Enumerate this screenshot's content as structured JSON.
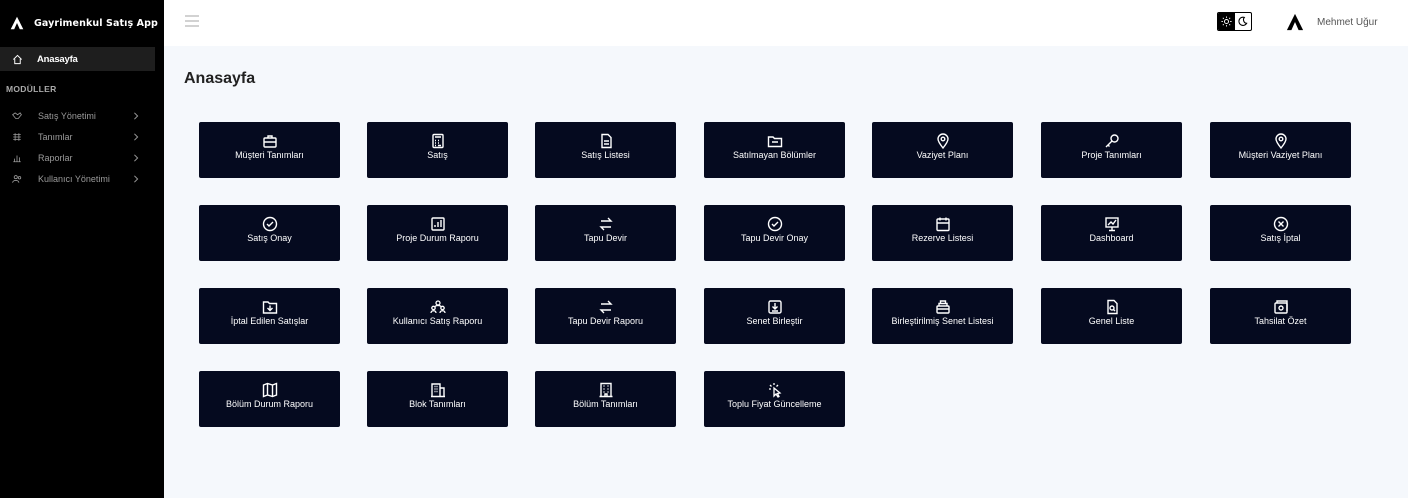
{
  "app": {
    "title": "Gayrimenkul Satış App"
  },
  "sidebar": {
    "active_item": {
      "label": "Anasayfa",
      "icon": "home-icon"
    },
    "section_title": "MODÜLLER",
    "items": [
      {
        "label": "Satış Yönetimi",
        "icon": "handshake-icon"
      },
      {
        "label": "Tanımlar",
        "icon": "grid-icon"
      },
      {
        "label": "Raporlar",
        "icon": "bar-chart-icon"
      },
      {
        "label": "Kullanıcı Yönetimi",
        "icon": "users-icon"
      }
    ]
  },
  "header": {
    "user_name": "Mehmet Uğur",
    "theme_options": [
      "light",
      "dark"
    ]
  },
  "main": {
    "page_title": "Anasayfa",
    "tiles": [
      {
        "label": "Müşteri Tanımları",
        "icon": "briefcase-icon"
      },
      {
        "label": "Satış",
        "icon": "calculator-icon"
      },
      {
        "label": "Satış Listesi",
        "icon": "document-icon"
      },
      {
        "label": "Satılmayan Bölümler",
        "icon": "folder-icon"
      },
      {
        "label": "Vaziyet Planı",
        "icon": "location-pin-icon"
      },
      {
        "label": "Proje Tanımları",
        "icon": "key-icon"
      },
      {
        "label": "Müşteri Vaziyet Planı",
        "icon": "location-pin-icon"
      },
      {
        "label": "Satış Onay",
        "icon": "check-circle-icon"
      },
      {
        "label": "Proje Durum Raporu",
        "icon": "bar-chart-icon"
      },
      {
        "label": "Tapu Devir",
        "icon": "transfer-arrows-icon"
      },
      {
        "label": "Tapu Devir Onay",
        "icon": "check-circle-icon"
      },
      {
        "label": "Rezerve Listesi",
        "icon": "calendar-icon"
      },
      {
        "label": "Dashboard",
        "icon": "presentation-chart-icon"
      },
      {
        "label": "Satış İptal",
        "icon": "x-circle-icon"
      },
      {
        "label": "İptal Edilen Satışlar",
        "icon": "folder-download-icon"
      },
      {
        "label": "Kullanıcı Satış Raporu",
        "icon": "users-icon"
      },
      {
        "label": "Tapu Devir Raporu",
        "icon": "transfer-arrows-icon"
      },
      {
        "label": "Senet Birleştir",
        "icon": "merge-download-icon"
      },
      {
        "label": "Birleştirilmiş Senet Listesi",
        "icon": "stack-icon"
      },
      {
        "label": "Genel Liste",
        "icon": "document-search-icon"
      },
      {
        "label": "Tahsilat Özet",
        "icon": "money-icon"
      },
      {
        "label": "Bölüm Durum Raporu",
        "icon": "map-icon"
      },
      {
        "label": "Blok Tanımları",
        "icon": "building-icon"
      },
      {
        "label": "Bölüm Tanımları",
        "icon": "building-icon"
      },
      {
        "label": "Toplu Fiyat Güncelleme",
        "icon": "cursor-click-icon"
      }
    ]
  }
}
